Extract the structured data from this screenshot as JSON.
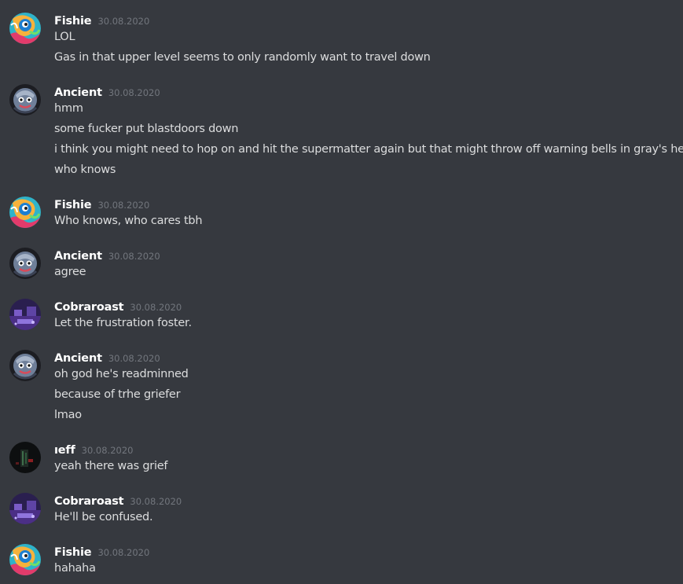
{
  "colors": {
    "background": "#36393f",
    "username": "#ffffff",
    "timestamp": "#72767d",
    "message_text": "#dcddde"
  },
  "groups": [
    {
      "avatar": "fishie-avatar",
      "username": "Fishie",
      "timestamp": "30.08.2020",
      "lines": [
        "LOL",
        "Gas in that upper level seems to only randomly want to travel down"
      ]
    },
    {
      "avatar": "ancient-avatar",
      "username": "Ancient",
      "timestamp": "30.08.2020",
      "lines": [
        "hmm",
        "some fucker put blastdoors down",
        "i think you might need to hop on and hit the supermatter again but that might throw off warning bells in gray's head",
        "who knows"
      ]
    },
    {
      "avatar": "fishie-avatar",
      "username": "Fishie",
      "timestamp": "30.08.2020",
      "lines": [
        "Who knows, who cares tbh"
      ]
    },
    {
      "avatar": "ancient-avatar",
      "username": "Ancient",
      "timestamp": "30.08.2020",
      "lines": [
        "agree"
      ]
    },
    {
      "avatar": "cobraroast-avatar",
      "username": "Cobraroast",
      "timestamp": "30.08.2020",
      "lines": [
        "Let the frustration foster."
      ]
    },
    {
      "avatar": "ancient-avatar",
      "username": "Ancient",
      "timestamp": "30.08.2020",
      "lines": [
        "oh god he's readminned",
        "because of trhe griefer",
        "lmao"
      ]
    },
    {
      "avatar": "jeff-avatar",
      "username": "ıeff",
      "timestamp": "30.08.2020",
      "lines": [
        "yeah there was grief"
      ]
    },
    {
      "avatar": "cobraroast-avatar",
      "username": "Cobraroast",
      "timestamp": "30.08.2020",
      "lines": [
        "He'll be confused."
      ]
    },
    {
      "avatar": "fishie-avatar",
      "username": "Fishie",
      "timestamp": "30.08.2020",
      "lines": [
        "hahaha"
      ]
    }
  ]
}
